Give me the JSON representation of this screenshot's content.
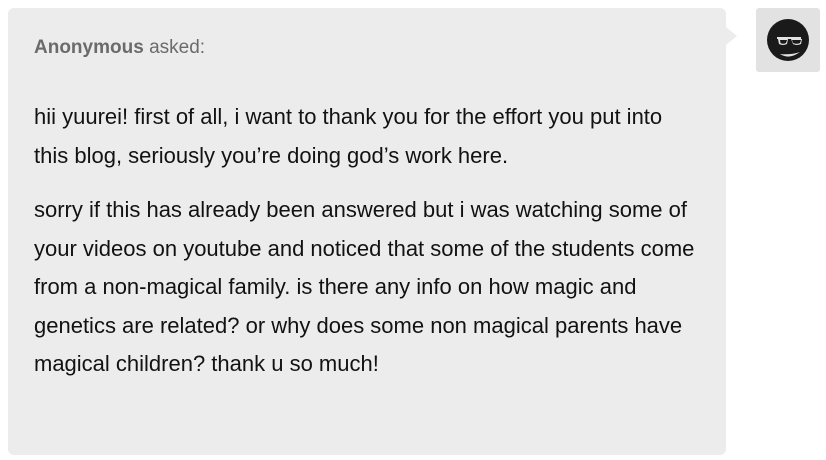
{
  "ask": {
    "asker_name": "Anonymous",
    "asker_verb": "asked:",
    "paragraphs": [
      "hii yuurei! first of all, i want to thank you for the effort you put into this blog, seriously you’re doing god’s work here.",
      "sorry if this has already been answered but i was watching some of your videos on youtube and noticed that some of the students come from a non-magical family. is there any info on how magic and genetics are related? or why does some non magical parents have magical children? thank u so much!"
    ]
  },
  "avatar": {
    "icon": "sunglasses-face-icon",
    "bg_color": "#e2e2e2",
    "face_color": "#1a1a1a"
  },
  "colors": {
    "bubble_bg": "#ececec",
    "text": "#121212",
    "muted_text": "#6b6b6b"
  }
}
